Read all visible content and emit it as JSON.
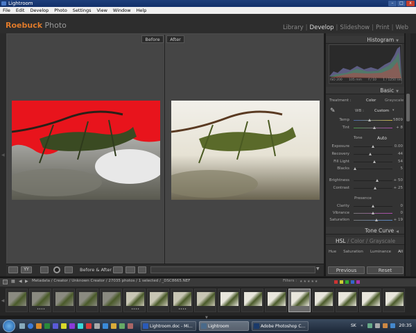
{
  "window": {
    "title": "Lightroom",
    "minimize": "–",
    "maximize": "□",
    "close": "x"
  },
  "menu": [
    "File",
    "Edit",
    "Develop",
    "Photo",
    "Settings",
    "View",
    "Window",
    "Help"
  ],
  "identity_plate": {
    "brand_1": "Roebuck",
    "brand_2": "Photo"
  },
  "modules": {
    "library": "Library",
    "develop": "Develop",
    "slideshow": "Slideshow",
    "print": "Print",
    "web": "Web",
    "separator": "|",
    "active": "develop"
  },
  "compare": {
    "before_label": "Before",
    "after_label": "After"
  },
  "toolbar": {
    "before_after_label": "Before & After :"
  },
  "histogram": {
    "title": "Histogram",
    "info": {
      "iso": "ISO 200",
      "focal": "105 mm",
      "aperture": "f / 10",
      "shutter": "1 / 1250 sec"
    }
  },
  "basic": {
    "title": "Basic",
    "treatment_label": "Treatment :",
    "treatment_color": "Color",
    "treatment_grayscale": "Grayscale",
    "wb_label": "WB :",
    "wb_value": "Custom",
    "tone_label": "Tone",
    "auto_label": "Auto",
    "presence_label": "Presence",
    "sliders": {
      "temp": {
        "label": "Temp",
        "value": "5809",
        "pos": 0.42
      },
      "tint": {
        "label": "Tint",
        "value": "+ 8",
        "pos": 0.55
      },
      "exposure": {
        "label": "Exposure",
        "value": "0.00",
        "pos": 0.5
      },
      "recovery": {
        "label": "Recovery",
        "value": "44",
        "pos": 0.44
      },
      "fill_light": {
        "label": "Fill Light",
        "value": "54",
        "pos": 0.54
      },
      "blacks": {
        "label": "Blacks",
        "value": "5",
        "pos": 0.05
      },
      "brightness": {
        "label": "Brightness",
        "value": "+ 50",
        "pos": 0.62
      },
      "contrast": {
        "label": "Contrast",
        "value": "+ 25",
        "pos": 0.56
      },
      "clarity": {
        "label": "Clarity",
        "value": "0",
        "pos": 0.5
      },
      "vibrance": {
        "label": "Vibrance",
        "value": "0",
        "pos": 0.5
      },
      "saturation": {
        "label": "Saturation",
        "value": "+ 19",
        "pos": 0.6
      }
    }
  },
  "tone_curve": {
    "title": "Tone Curve"
  },
  "hsl": {
    "tab_hsl": "HSL",
    "tab_color": "Color",
    "tab_grayscale": "Grayscale",
    "sep": "/",
    "sub_hue": "Hue",
    "sub_saturation": "Saturation",
    "sub_luminance": "Luminance",
    "sub_all": "All"
  },
  "buttons": {
    "previous": "Previous",
    "reset": "Reset"
  },
  "filmstrip_bar": {
    "path": "Metadata / Creator / Unknown Creator / 27035 photos / 1 selected / _DSC8665.NEF",
    "filters_label": "Filters :"
  },
  "filmstrip": {
    "count": 17,
    "selected_index": 12
  },
  "taskbar": {
    "tasks": [
      "Lightroom.doc - Mi...",
      "Lightroom",
      "Adobe Photoshop C..."
    ],
    "lang": "SK",
    "clock": "20:35"
  },
  "colors": {
    "accent": "#e07a2a",
    "panel": "#333333",
    "clip_red": "#e8141c"
  }
}
